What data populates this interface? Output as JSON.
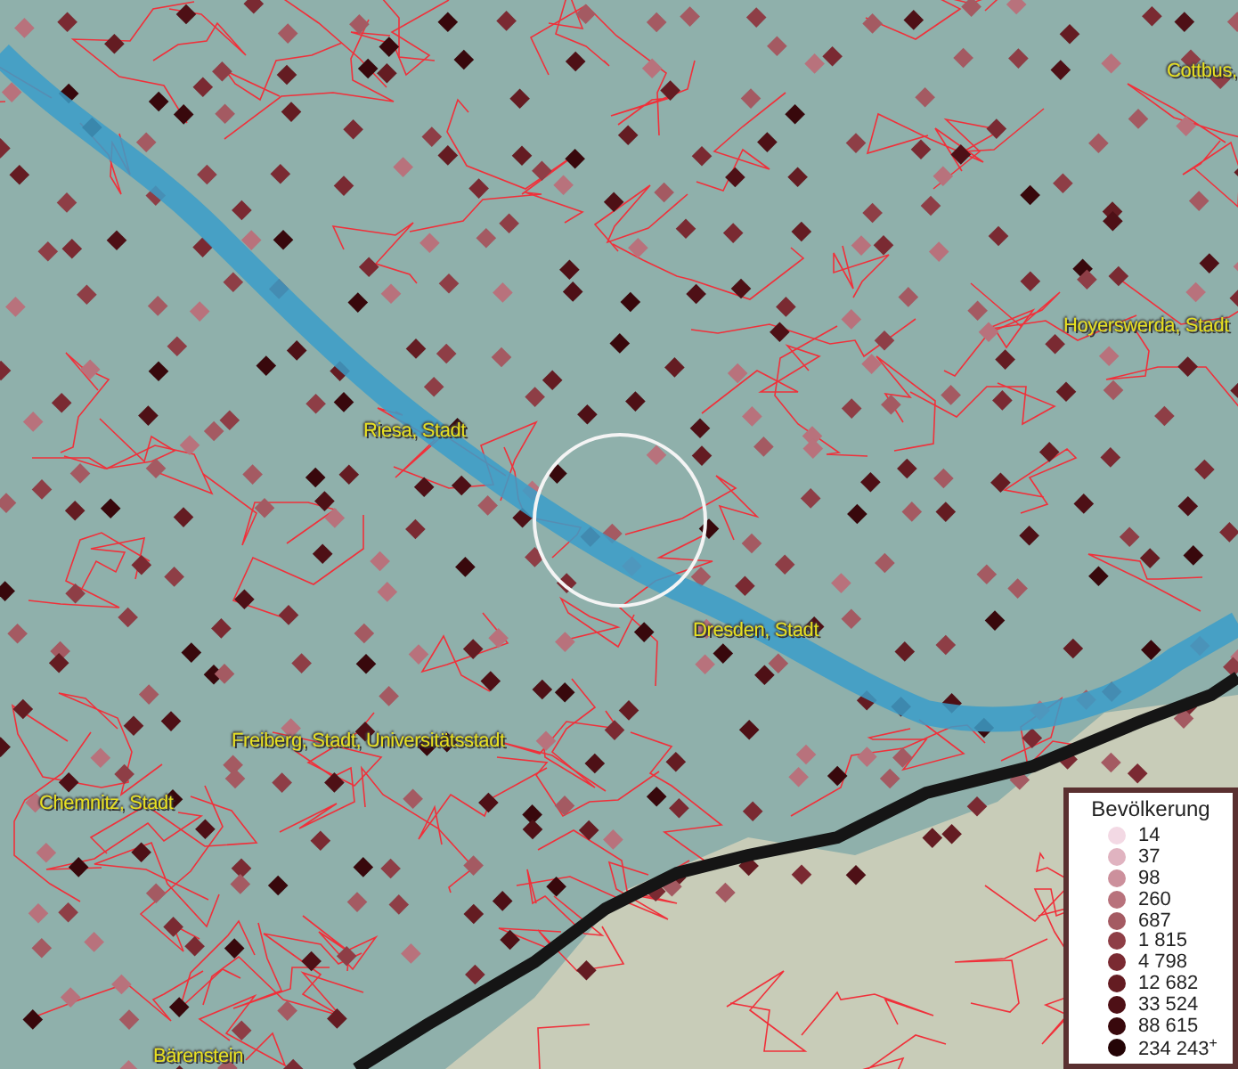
{
  "map": {
    "places": [
      {
        "name": "Cottbus,"
      },
      {
        "name": "Hoyerswerda, Stadt"
      },
      {
        "name": "Riesa, Stadt"
      },
      {
        "name": "Dresden, Stadt"
      },
      {
        "name": "Freiberg, Stadt, Universitätsstadt"
      },
      {
        "name": "Chemnitz, Stadt"
      },
      {
        "name": "Bärenstein"
      }
    ]
  },
  "legend": {
    "title": "Bevölkerung",
    "items": [
      {
        "label": "14",
        "color": "#f3d9e4"
      },
      {
        "label": "37",
        "color": "#e0b3c0"
      },
      {
        "label": "98",
        "color": "#cc909c"
      },
      {
        "label": "260",
        "color": "#b8727c"
      },
      {
        "label": "687",
        "color": "#a45a62"
      },
      {
        "label": "1 815",
        "color": "#8e3e46"
      },
      {
        "label": "4 798",
        "color": "#7a2a32"
      },
      {
        "label": "12 682",
        "color": "#641c22"
      },
      {
        "label": "33 524",
        "color": "#4e1016"
      },
      {
        "label": "88 615",
        "color": "#38080c"
      },
      {
        "label": "234 243$^{+}$",
        "color": "#240406"
      }
    ]
  }
}
